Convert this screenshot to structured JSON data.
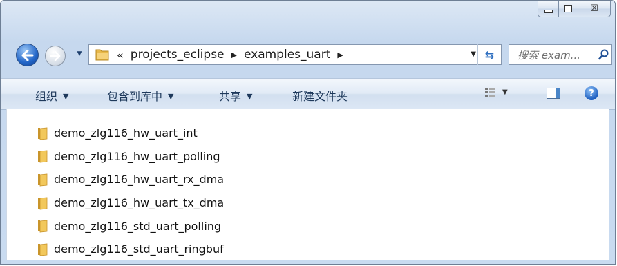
{
  "window": {
    "caption_buttons": {
      "minimize_icon": "minimize-icon",
      "maximize_icon": "maximize-icon",
      "close_glyph": "☒"
    }
  },
  "nav": {
    "breadcrumb": {
      "overflow": "«",
      "items": [
        "projects_eclipse",
        "examples_uart"
      ]
    },
    "search": {
      "placeholder": "搜索 exam..."
    }
  },
  "commands": {
    "organize": "组织",
    "include_in_library": "包含到库中",
    "share": "共享",
    "new_folder": "新建文件夹"
  },
  "files": [
    "demo_zlg116_hw_uart_int",
    "demo_zlg116_hw_uart_polling",
    "demo_zlg116_hw_uart_rx_dma",
    "demo_zlg116_hw_uart_tx_dma",
    "demo_zlg116_std_uart_polling",
    "demo_zlg116_std_uart_ringbuf"
  ],
  "colors": {
    "frame": "#c9dbf0",
    "command_text": "#1e395b",
    "folder": "#e8b84a"
  }
}
